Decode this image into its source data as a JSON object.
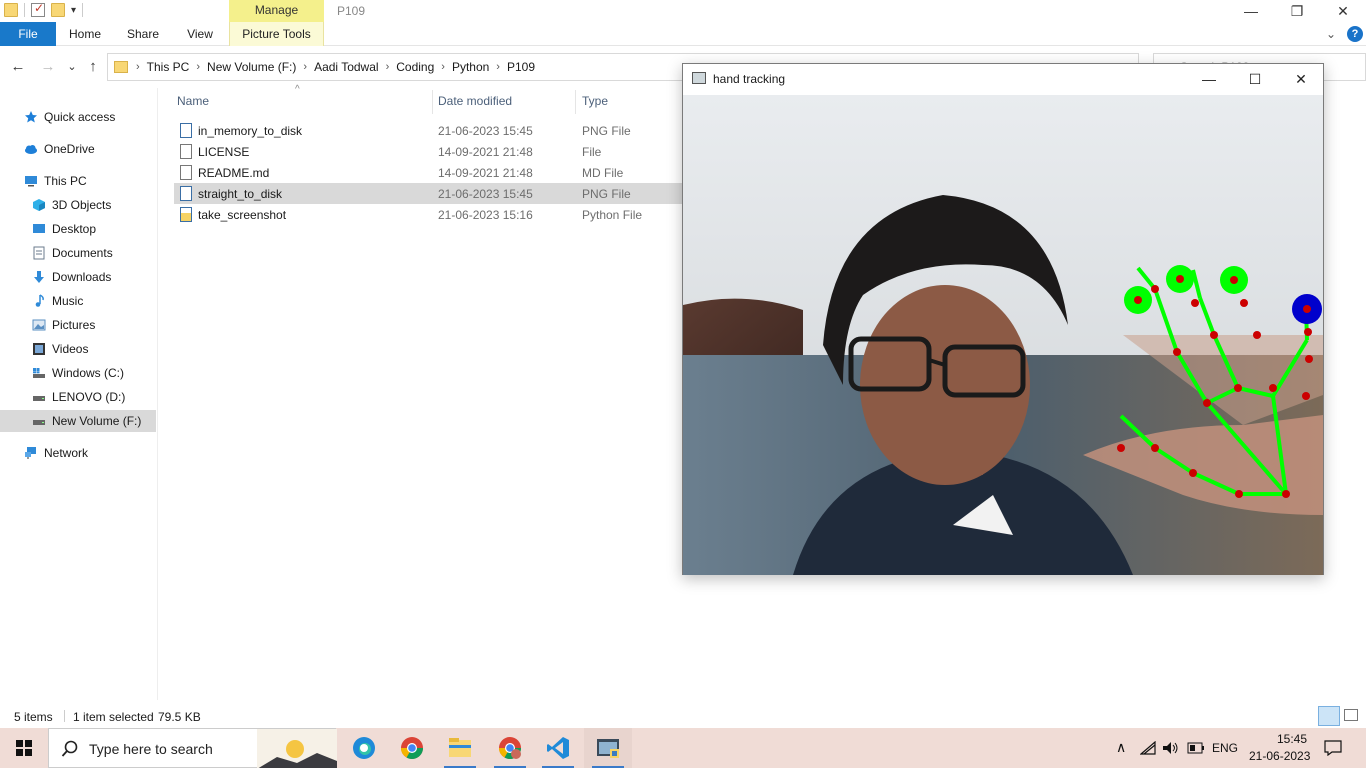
{
  "titlebar": {
    "manage_label": "Manage",
    "window_title": "P109",
    "minimize": "—",
    "restore": "❐",
    "close": "✕"
  },
  "ribbon": {
    "file": "File",
    "home": "Home",
    "share": "Share",
    "view": "View",
    "picture_tools": "Picture Tools",
    "chevron": "⌄",
    "help": "?"
  },
  "address": {
    "back": "←",
    "forward": "→",
    "recent": "⌄",
    "up": "↑",
    "crumbs": [
      "This PC",
      "New Volume (F:)",
      "Aadi Todwal",
      "Coding",
      "Python",
      "P109"
    ],
    "separator": "›",
    "dropdown": "⌄",
    "search_placeholder": "Search P109"
  },
  "nav": {
    "items": [
      {
        "label": "Quick access",
        "icon": "star-icon",
        "color": "#1e7fd8"
      },
      {
        "label": "OneDrive",
        "icon": "cloud-icon",
        "color": "#1e7fd8"
      },
      {
        "label": "This PC",
        "icon": "computer-icon",
        "color": "#2f8ad8"
      },
      {
        "label": "3D Objects",
        "icon": "cube-icon",
        "color": "#2fb0e8"
      },
      {
        "label": "Desktop",
        "icon": "desktop-icon",
        "color": "#2f8ad8"
      },
      {
        "label": "Documents",
        "icon": "documents-icon",
        "color": "#6b7b8c"
      },
      {
        "label": "Downloads",
        "icon": "download-icon",
        "color": "#2f8ad8"
      },
      {
        "label": "Music",
        "icon": "music-icon",
        "color": "#2f8ad8"
      },
      {
        "label": "Pictures",
        "icon": "pictures-icon",
        "color": "#5a8fc2"
      },
      {
        "label": "Videos",
        "icon": "videos-icon",
        "color": "#333333"
      },
      {
        "label": "Windows (C:)",
        "icon": "drive-windows-icon",
        "color": "#666666"
      },
      {
        "label": "LENOVO (D:)",
        "icon": "drive-icon",
        "color": "#666666"
      },
      {
        "label": "New Volume (F:)",
        "icon": "drive-icon",
        "color": "#666666"
      },
      {
        "label": "Network",
        "icon": "network-icon",
        "color": "#2f8ad8"
      }
    ]
  },
  "files": {
    "headers": {
      "name": "Name",
      "date": "Date modified",
      "type": "Type"
    },
    "sort_arrow": "^",
    "rows": [
      {
        "name": "in_memory_to_disk",
        "date": "21-06-2023 15:45",
        "type": "PNG File",
        "icon": "image-file-icon"
      },
      {
        "name": "LICENSE",
        "date": "14-09-2021 21:48",
        "type": "File",
        "icon": "file-icon"
      },
      {
        "name": "README.md",
        "date": "14-09-2021 21:48",
        "type": "MD File",
        "icon": "file-icon"
      },
      {
        "name": "straight_to_disk",
        "date": "21-06-2023 15:45",
        "type": "PNG File",
        "icon": "image-file-icon",
        "selected": true
      },
      {
        "name": "take_screenshot",
        "date": "21-06-2023 15:16",
        "type": "Python File",
        "icon": "python-file-icon"
      }
    ]
  },
  "status": {
    "count": "5 items",
    "selected": "1 item selected",
    "size": "79.5 KB"
  },
  "hand_window": {
    "title": "hand tracking",
    "minimize": "—",
    "maximize": "☐",
    "close": "✕"
  },
  "taskbar": {
    "search_placeholder": "Type here to search",
    "language": "ENG",
    "time": "15:45",
    "date": "21-06-2023",
    "tray_up": "∧"
  },
  "colors": {
    "accent": "#1979ca",
    "landmark": "#cc0000",
    "connection": "#00ff00",
    "thumb_tip": "#0000cc"
  }
}
